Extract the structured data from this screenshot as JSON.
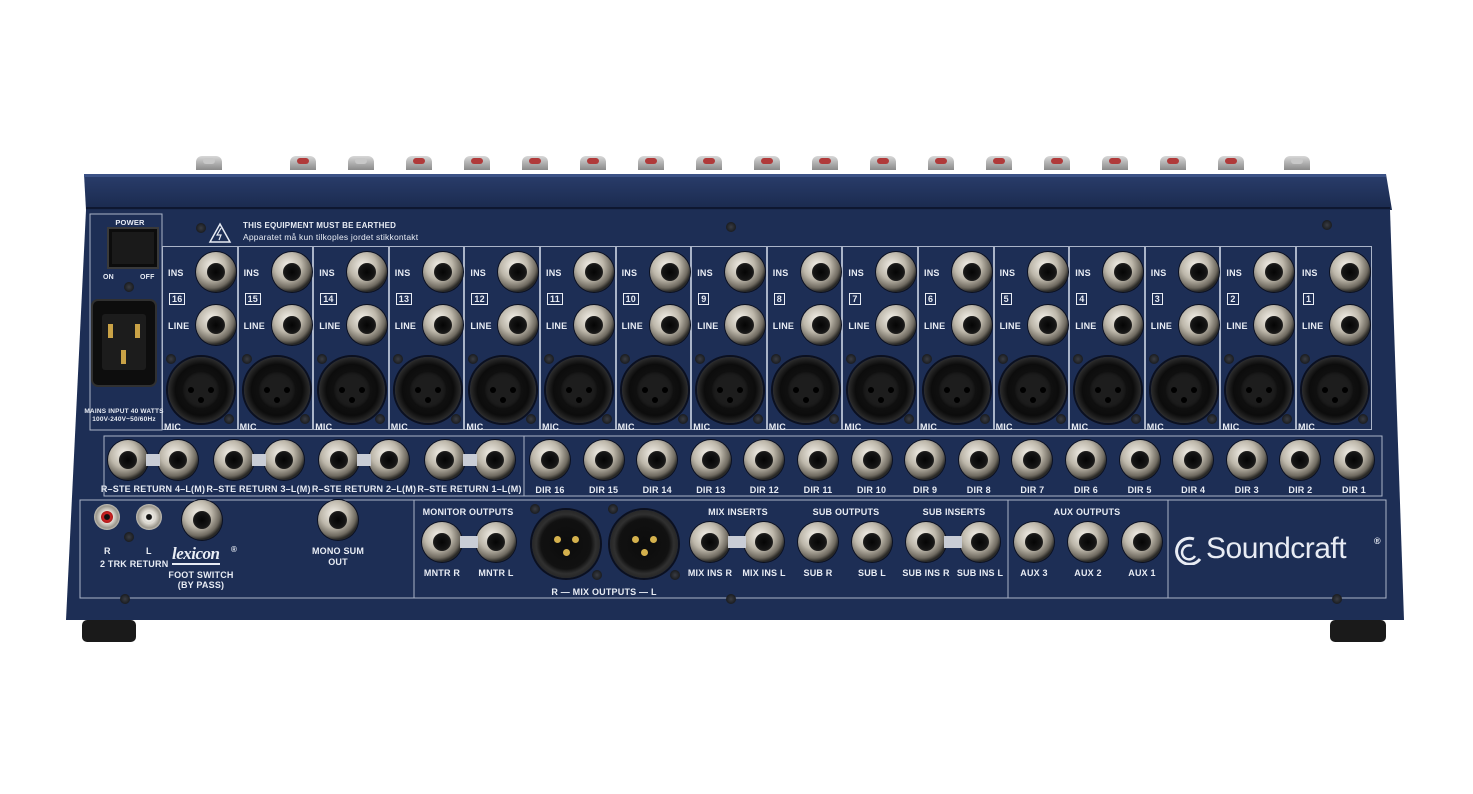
{
  "warning": {
    "title": "THIS EQUIPMENT MUST BE EARTHED",
    "subtitle": "Apparatet må kun tilkoples jordet stikkontakt"
  },
  "power": {
    "label": "POWER",
    "on": "ON",
    "off": "OFF",
    "mains": "MAINS INPUT 40 WATTS",
    "voltage": "100V-240V~50/60Hz"
  },
  "channel_row": {
    "ins": "INS",
    "line": "LINE",
    "mic": "MIC"
  },
  "channels": [
    "16",
    "15",
    "14",
    "13",
    "12",
    "11",
    "10",
    "9",
    "8",
    "7",
    "6",
    "5",
    "4",
    "3",
    "2",
    "1"
  ],
  "returns": [
    "R–STE RETURN 4–L(M)",
    "R–STE RETURN 3–L(M)",
    "R–STE RETURN 2–L(M)",
    "R–STE RETURN 1–L(M)"
  ],
  "directs": [
    "DIR 16",
    "DIR 15",
    "DIR 14",
    "DIR 13",
    "DIR 12",
    "DIR 11",
    "DIR 10",
    "DIR 9",
    "DIR 8",
    "DIR 7",
    "DIR 6",
    "DIR 5",
    "DIR 4",
    "DIR 3",
    "DIR 2",
    "DIR 1"
  ],
  "two_track": {
    "r": "R",
    "l": "L",
    "label": "2 TRK RETURN"
  },
  "lexicon": {
    "brand": "lexicon",
    "reg": "®",
    "line1": "FOOT SWITCH",
    "line2": "(BY PASS)"
  },
  "mono": {
    "line1": "MONO SUM",
    "line2": "OUT"
  },
  "monitor": {
    "title": "MONITOR OUTPUTS",
    "r": "MNTR R",
    "l": "MNTR L"
  },
  "mix_outputs": "R — MIX OUTPUTS — L",
  "mix_inserts": {
    "title": "MIX INSERTS",
    "r": "MIX INS R",
    "l": "MIX INS L"
  },
  "sub_outputs": {
    "title": "SUB OUTPUTS",
    "r": "SUB R",
    "l": "SUB L"
  },
  "sub_inserts": {
    "title": "SUB INSERTS",
    "r": "SUB INS R",
    "l": "SUB INS L"
  },
  "aux_outputs": {
    "title": "AUX OUTPUTS",
    "labels": [
      "AUX 3",
      "AUX 2",
      "AUX 1"
    ]
  },
  "brand": {
    "name": "Soundcraft",
    "reg": "®"
  },
  "colors": {
    "panel": "#1d2e55",
    "panel_dark": "#14213f",
    "line": "#aab4c8",
    "label": "#e8ecf4"
  }
}
